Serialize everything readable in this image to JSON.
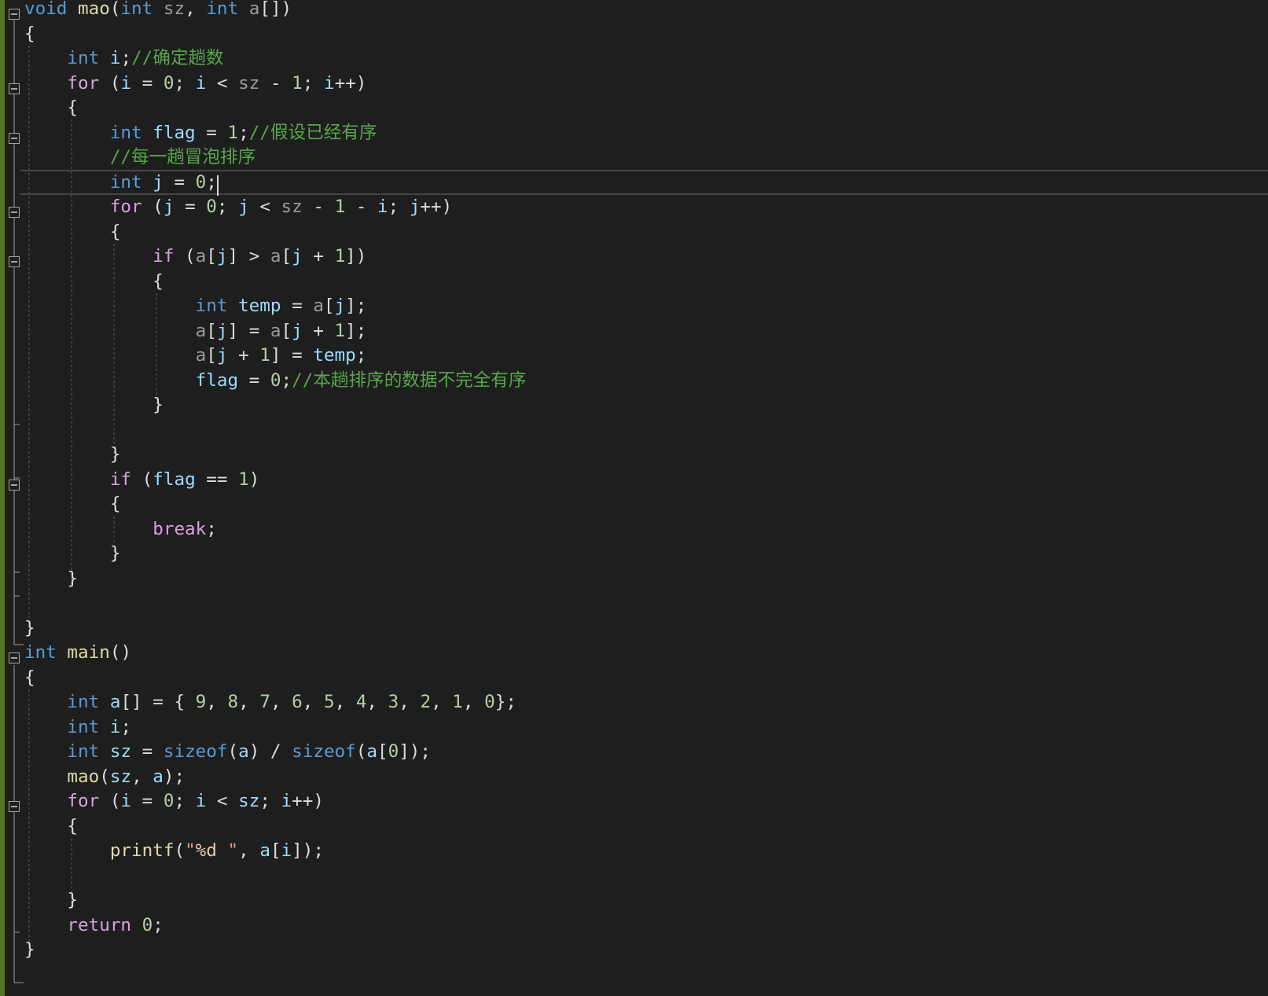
{
  "colors": {
    "background": "#1e1e1e",
    "keyword": "#569cd6",
    "control": "#d8a0df",
    "identifier": "#9cdcfe",
    "function": "#dcdcaa",
    "number": "#b5cea8",
    "comment": "#57a64a",
    "string": "#d69d85",
    "format": "#e8c9bb",
    "parameter": "#9a9a9a",
    "default": "#dcdcdc",
    "change_bar": "#57741f"
  },
  "icons": {
    "fold_marker": "collapse-minus-icon",
    "caret": "text-caret-icon"
  },
  "editor": {
    "current_line": 7,
    "lines": [
      [
        {
          "t": "void",
          "c": "keyword"
        },
        {
          "t": " ",
          "c": "default"
        },
        {
          "t": "mao",
          "c": "function"
        },
        {
          "t": "(",
          "c": "default"
        },
        {
          "t": "int",
          "c": "keyword"
        },
        {
          "t": " ",
          "c": "default"
        },
        {
          "t": "sz",
          "c": "parameter"
        },
        {
          "t": ", ",
          "c": "default"
        },
        {
          "t": "int",
          "c": "keyword"
        },
        {
          "t": " ",
          "c": "default"
        },
        {
          "t": "a",
          "c": "parameter"
        },
        {
          "t": "[])",
          "c": "default"
        }
      ],
      [
        {
          "t": "{",
          "c": "default"
        }
      ],
      [
        {
          "t": "    ",
          "c": "default"
        },
        {
          "t": "int",
          "c": "keyword"
        },
        {
          "t": " ",
          "c": "default"
        },
        {
          "t": "i",
          "c": "identifier"
        },
        {
          "t": ";",
          "c": "default"
        },
        {
          "t": "//确定趟数",
          "c": "comment"
        }
      ],
      [
        {
          "t": "    ",
          "c": "default"
        },
        {
          "t": "for",
          "c": "control"
        },
        {
          "t": " (",
          "c": "default"
        },
        {
          "t": "i",
          "c": "identifier"
        },
        {
          "t": " = ",
          "c": "default"
        },
        {
          "t": "0",
          "c": "number"
        },
        {
          "t": "; ",
          "c": "default"
        },
        {
          "t": "i",
          "c": "identifier"
        },
        {
          "t": " < ",
          "c": "default"
        },
        {
          "t": "sz",
          "c": "parameter"
        },
        {
          "t": " - ",
          "c": "default"
        },
        {
          "t": "1",
          "c": "number"
        },
        {
          "t": "; ",
          "c": "default"
        },
        {
          "t": "i",
          "c": "identifier"
        },
        {
          "t": "++)",
          "c": "default"
        }
      ],
      [
        {
          "t": "    {",
          "c": "default"
        }
      ],
      [
        {
          "t": "        ",
          "c": "default"
        },
        {
          "t": "int",
          "c": "keyword"
        },
        {
          "t": " ",
          "c": "default"
        },
        {
          "t": "flag",
          "c": "identifier"
        },
        {
          "t": " = ",
          "c": "default"
        },
        {
          "t": "1",
          "c": "number"
        },
        {
          "t": ";",
          "c": "default"
        },
        {
          "t": "//假设已经有序",
          "c": "comment"
        }
      ],
      [
        {
          "t": "        ",
          "c": "default"
        },
        {
          "t": "//每一趟冒泡排序",
          "c": "comment"
        }
      ],
      [
        {
          "t": "        ",
          "c": "default"
        },
        {
          "t": "int",
          "c": "keyword"
        },
        {
          "t": " ",
          "c": "default"
        },
        {
          "t": "j",
          "c": "identifier"
        },
        {
          "t": " = ",
          "c": "default"
        },
        {
          "t": "0",
          "c": "number"
        },
        {
          "t": ";",
          "c": "default"
        }
      ],
      [
        {
          "t": "        ",
          "c": "default"
        },
        {
          "t": "for",
          "c": "control"
        },
        {
          "t": " (",
          "c": "default"
        },
        {
          "t": "j",
          "c": "identifier"
        },
        {
          "t": " = ",
          "c": "default"
        },
        {
          "t": "0",
          "c": "number"
        },
        {
          "t": "; ",
          "c": "default"
        },
        {
          "t": "j",
          "c": "identifier"
        },
        {
          "t": " < ",
          "c": "default"
        },
        {
          "t": "sz",
          "c": "parameter"
        },
        {
          "t": " - ",
          "c": "default"
        },
        {
          "t": "1",
          "c": "number"
        },
        {
          "t": " - ",
          "c": "default"
        },
        {
          "t": "i",
          "c": "identifier"
        },
        {
          "t": "; ",
          "c": "default"
        },
        {
          "t": "j",
          "c": "identifier"
        },
        {
          "t": "++)",
          "c": "default"
        }
      ],
      [
        {
          "t": "        {",
          "c": "default"
        }
      ],
      [
        {
          "t": "            ",
          "c": "default"
        },
        {
          "t": "if",
          "c": "control"
        },
        {
          "t": " (",
          "c": "default"
        },
        {
          "t": "a",
          "c": "parameter"
        },
        {
          "t": "[",
          "c": "default"
        },
        {
          "t": "j",
          "c": "identifier"
        },
        {
          "t": "] > ",
          "c": "default"
        },
        {
          "t": "a",
          "c": "parameter"
        },
        {
          "t": "[",
          "c": "default"
        },
        {
          "t": "j",
          "c": "identifier"
        },
        {
          "t": " + ",
          "c": "default"
        },
        {
          "t": "1",
          "c": "number"
        },
        {
          "t": "])",
          "c": "default"
        }
      ],
      [
        {
          "t": "            {",
          "c": "default"
        }
      ],
      [
        {
          "t": "                ",
          "c": "default"
        },
        {
          "t": "int",
          "c": "keyword"
        },
        {
          "t": " ",
          "c": "default"
        },
        {
          "t": "temp",
          "c": "identifier"
        },
        {
          "t": " = ",
          "c": "default"
        },
        {
          "t": "a",
          "c": "parameter"
        },
        {
          "t": "[",
          "c": "default"
        },
        {
          "t": "j",
          "c": "identifier"
        },
        {
          "t": "];",
          "c": "default"
        }
      ],
      [
        {
          "t": "                ",
          "c": "default"
        },
        {
          "t": "a",
          "c": "parameter"
        },
        {
          "t": "[",
          "c": "default"
        },
        {
          "t": "j",
          "c": "identifier"
        },
        {
          "t": "] = ",
          "c": "default"
        },
        {
          "t": "a",
          "c": "parameter"
        },
        {
          "t": "[",
          "c": "default"
        },
        {
          "t": "j",
          "c": "identifier"
        },
        {
          "t": " + ",
          "c": "default"
        },
        {
          "t": "1",
          "c": "number"
        },
        {
          "t": "];",
          "c": "default"
        }
      ],
      [
        {
          "t": "                ",
          "c": "default"
        },
        {
          "t": "a",
          "c": "parameter"
        },
        {
          "t": "[",
          "c": "default"
        },
        {
          "t": "j",
          "c": "identifier"
        },
        {
          "t": " + ",
          "c": "default"
        },
        {
          "t": "1",
          "c": "number"
        },
        {
          "t": "] = ",
          "c": "default"
        },
        {
          "t": "temp",
          "c": "identifier"
        },
        {
          "t": ";",
          "c": "default"
        }
      ],
      [
        {
          "t": "                ",
          "c": "default"
        },
        {
          "t": "flag",
          "c": "identifier"
        },
        {
          "t": " = ",
          "c": "default"
        },
        {
          "t": "0",
          "c": "number"
        },
        {
          "t": ";",
          "c": "default"
        },
        {
          "t": "//本趟排序的数据不完全有序",
          "c": "comment"
        }
      ],
      [
        {
          "t": "            }",
          "c": "default"
        }
      ],
      [],
      [
        {
          "t": "        }",
          "c": "default"
        }
      ],
      [
        {
          "t": "        ",
          "c": "default"
        },
        {
          "t": "if",
          "c": "control"
        },
        {
          "t": " (",
          "c": "default"
        },
        {
          "t": "flag",
          "c": "identifier"
        },
        {
          "t": " == ",
          "c": "default"
        },
        {
          "t": "1",
          "c": "number"
        },
        {
          "t": ")",
          "c": "default"
        }
      ],
      [
        {
          "t": "        {",
          "c": "default"
        }
      ],
      [
        {
          "t": "            ",
          "c": "default"
        },
        {
          "t": "break",
          "c": "control"
        },
        {
          "t": ";",
          "c": "default"
        }
      ],
      [
        {
          "t": "        }",
          "c": "default"
        }
      ],
      [
        {
          "t": "    }",
          "c": "default"
        }
      ],
      [],
      [
        {
          "t": "}",
          "c": "default"
        }
      ],
      [
        {
          "t": "int",
          "c": "keyword"
        },
        {
          "t": " ",
          "c": "default"
        },
        {
          "t": "main",
          "c": "function"
        },
        {
          "t": "()",
          "c": "default"
        }
      ],
      [
        {
          "t": "{",
          "c": "default"
        }
      ],
      [
        {
          "t": "    ",
          "c": "default"
        },
        {
          "t": "int",
          "c": "keyword"
        },
        {
          "t": " ",
          "c": "default"
        },
        {
          "t": "a",
          "c": "identifier"
        },
        {
          "t": "[] = { ",
          "c": "default"
        },
        {
          "t": "9",
          "c": "number"
        },
        {
          "t": ", ",
          "c": "default"
        },
        {
          "t": "8",
          "c": "number"
        },
        {
          "t": ", ",
          "c": "default"
        },
        {
          "t": "7",
          "c": "number"
        },
        {
          "t": ", ",
          "c": "default"
        },
        {
          "t": "6",
          "c": "number"
        },
        {
          "t": ", ",
          "c": "default"
        },
        {
          "t": "5",
          "c": "number"
        },
        {
          "t": ", ",
          "c": "default"
        },
        {
          "t": "4",
          "c": "number"
        },
        {
          "t": ", ",
          "c": "default"
        },
        {
          "t": "3",
          "c": "number"
        },
        {
          "t": ", ",
          "c": "default"
        },
        {
          "t": "2",
          "c": "number"
        },
        {
          "t": ", ",
          "c": "default"
        },
        {
          "t": "1",
          "c": "number"
        },
        {
          "t": ", ",
          "c": "default"
        },
        {
          "t": "0",
          "c": "number"
        },
        {
          "t": "};",
          "c": "default"
        }
      ],
      [
        {
          "t": "    ",
          "c": "default"
        },
        {
          "t": "int",
          "c": "keyword"
        },
        {
          "t": " ",
          "c": "default"
        },
        {
          "t": "i",
          "c": "identifier"
        },
        {
          "t": ";",
          "c": "default"
        }
      ],
      [
        {
          "t": "    ",
          "c": "default"
        },
        {
          "t": "int",
          "c": "keyword"
        },
        {
          "t": " ",
          "c": "default"
        },
        {
          "t": "sz",
          "c": "identifier"
        },
        {
          "t": " = ",
          "c": "default"
        },
        {
          "t": "sizeof",
          "c": "keyword"
        },
        {
          "t": "(",
          "c": "default"
        },
        {
          "t": "a",
          "c": "identifier"
        },
        {
          "t": ") / ",
          "c": "default"
        },
        {
          "t": "sizeof",
          "c": "keyword"
        },
        {
          "t": "(",
          "c": "default"
        },
        {
          "t": "a",
          "c": "identifier"
        },
        {
          "t": "[",
          "c": "default"
        },
        {
          "t": "0",
          "c": "number"
        },
        {
          "t": "]);",
          "c": "default"
        }
      ],
      [
        {
          "t": "    ",
          "c": "default"
        },
        {
          "t": "mao",
          "c": "function"
        },
        {
          "t": "(",
          "c": "default"
        },
        {
          "t": "sz",
          "c": "identifier"
        },
        {
          "t": ", ",
          "c": "default"
        },
        {
          "t": "a",
          "c": "identifier"
        },
        {
          "t": ");",
          "c": "default"
        }
      ],
      [
        {
          "t": "    ",
          "c": "default"
        },
        {
          "t": "for",
          "c": "control"
        },
        {
          "t": " (",
          "c": "default"
        },
        {
          "t": "i",
          "c": "identifier"
        },
        {
          "t": " = ",
          "c": "default"
        },
        {
          "t": "0",
          "c": "number"
        },
        {
          "t": "; ",
          "c": "default"
        },
        {
          "t": "i",
          "c": "identifier"
        },
        {
          "t": " < ",
          "c": "default"
        },
        {
          "t": "sz",
          "c": "identifier"
        },
        {
          "t": "; ",
          "c": "default"
        },
        {
          "t": "i",
          "c": "identifier"
        },
        {
          "t": "++)",
          "c": "default"
        }
      ],
      [
        {
          "t": "    {",
          "c": "default"
        }
      ],
      [
        {
          "t": "        ",
          "c": "default"
        },
        {
          "t": "printf",
          "c": "function"
        },
        {
          "t": "(",
          "c": "default"
        },
        {
          "t": "\"",
          "c": "string"
        },
        {
          "t": "%d",
          "c": "format"
        },
        {
          "t": " \"",
          "c": "string"
        },
        {
          "t": ", ",
          "c": "default"
        },
        {
          "t": "a",
          "c": "identifier"
        },
        {
          "t": "[",
          "c": "default"
        },
        {
          "t": "i",
          "c": "identifier"
        },
        {
          "t": "]);",
          "c": "default"
        }
      ],
      [],
      [
        {
          "t": "    }",
          "c": "default"
        }
      ],
      [
        {
          "t": "    ",
          "c": "default"
        },
        {
          "t": "return",
          "c": "control"
        },
        {
          "t": " ",
          "c": "default"
        },
        {
          "t": "0",
          "c": "number"
        },
        {
          "t": ";",
          "c": "default"
        }
      ],
      [
        {
          "t": "}",
          "c": "default"
        }
      ]
    ]
  }
}
